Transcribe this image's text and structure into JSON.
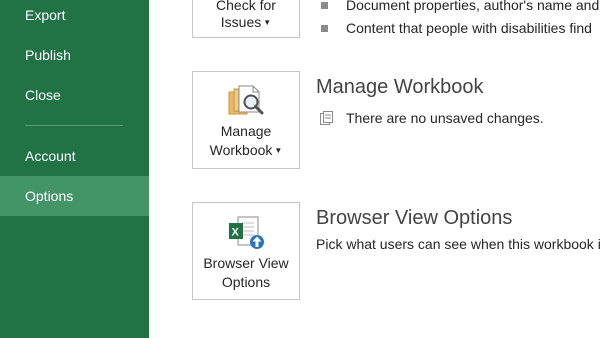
{
  "sidebar": {
    "items": [
      {
        "label": "Export"
      },
      {
        "label": "Publish"
      },
      {
        "label": "Close"
      },
      {
        "label": "Account"
      },
      {
        "label": "Options"
      }
    ],
    "selected": "Options"
  },
  "inspect": {
    "button_line1": "Check for",
    "button_line2": "Issues",
    "bullets": [
      "Document properties, author's name and",
      "Content that people with disabilities find"
    ]
  },
  "manage": {
    "button_line1": "Manage",
    "button_line2": "Workbook",
    "title": "Manage Workbook",
    "status": "There are no unsaved changes."
  },
  "browser_view": {
    "button_line1": "Browser View",
    "button_line2": "Options",
    "title": "Browser View Options",
    "description": "Pick what users can see when this workbook is"
  },
  "colors": {
    "sidebar": "#217346",
    "sidebar_selected": "#439467"
  }
}
